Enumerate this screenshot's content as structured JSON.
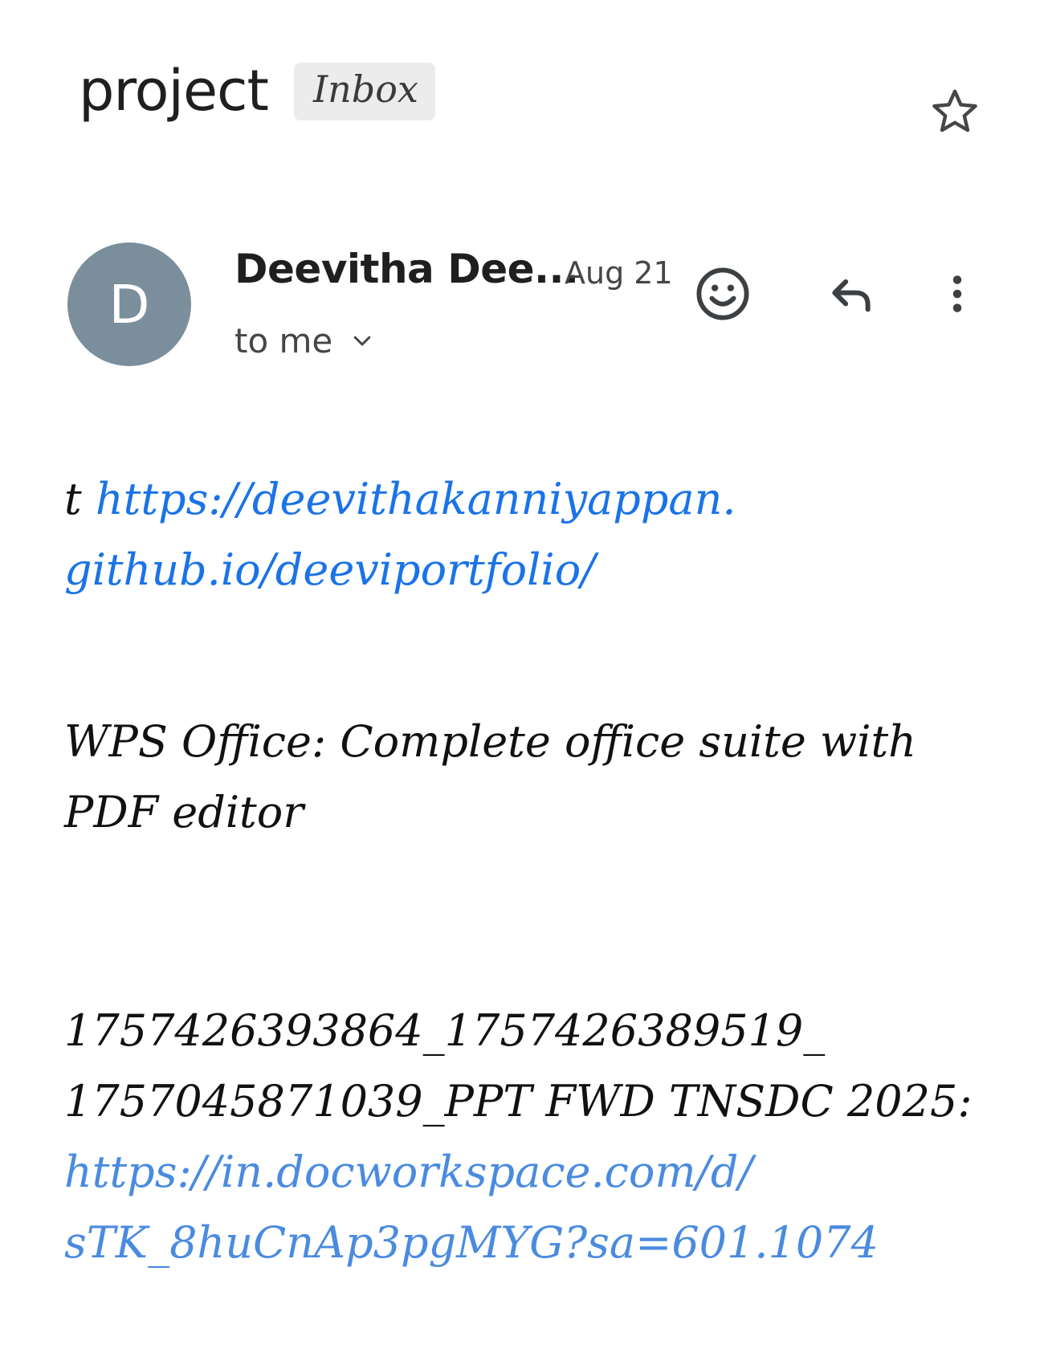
{
  "header": {
    "subject": "project",
    "label": "Inbox",
    "star_icon": "star-outline-icon"
  },
  "sender": {
    "avatar_letter": "D",
    "avatar_color": "#7a8e9b",
    "name": "Deevitha Dee...",
    "date": "Aug 21",
    "recipient": "to me"
  },
  "actions": {
    "emoji_icon": "add-reaction-icon",
    "reply_icon": "reply-icon",
    "more_icon": "more-vertical-icon"
  },
  "body": {
    "block1": {
      "prefix": "t ",
      "link_line1": "https://deevithakanniyappan.",
      "link_line2": "github.io/deeviportfolio/"
    },
    "block2": {
      "line1": "WPS Office: Complete office suite with",
      "line2": "PDF editor"
    },
    "block3": {
      "line1": "1757426393864_1757426389519_",
      "line2": "1757045871039_PPT FWD TNSDC 2025:",
      "link_line1": "https://in.docworkspace.com/d/",
      "link_line2": "sTK_8huCnAp3pgMYG?sa=601.1074"
    }
  },
  "colors": {
    "link": "#1a73e8",
    "text": "#1f1f1f",
    "chip_bg": "#ececec"
  }
}
